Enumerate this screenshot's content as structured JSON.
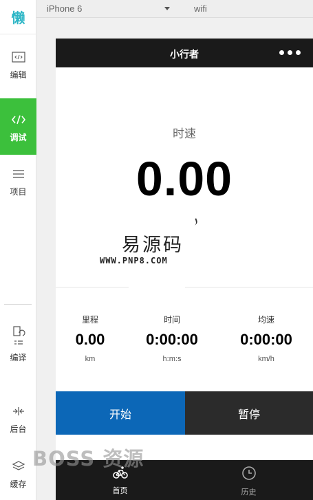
{
  "sidebar": {
    "logo": "懒",
    "tools": [
      {
        "name": "edit",
        "label": "编辑"
      },
      {
        "name": "debug",
        "label": "调试"
      },
      {
        "name": "project",
        "label": "项目"
      },
      {
        "name": "compile",
        "label": "编译"
      },
      {
        "name": "background",
        "label": "后台"
      },
      {
        "name": "cache",
        "label": "缓存"
      }
    ],
    "active_color": "#3cc03c"
  },
  "toolbar": {
    "device": "iPhone 6",
    "network": "wifi"
  },
  "navbar": {
    "title": "小行者"
  },
  "speed": {
    "label": "时速",
    "value": "0.00"
  },
  "watermark": {
    "title": "易源码",
    "url": "WWW.PNP8.COM",
    "brand": "BOSS 资源"
  },
  "stats": [
    {
      "label": "里程",
      "value": "0.00",
      "unit": "km"
    },
    {
      "label": "时间",
      "value": "0:00:00",
      "unit": "h:m:s"
    },
    {
      "label": "均速",
      "value": "0:00:00",
      "unit": "km/h"
    }
  ],
  "buttons": {
    "start": "开始",
    "pause": "暂停",
    "start_color": "#0c67b7",
    "pause_color": "#2b2b2b"
  },
  "tabs": [
    {
      "label": "首页",
      "icon": "bicycle-icon",
      "active": true
    },
    {
      "label": "历史",
      "icon": "clock-icon",
      "active": false
    }
  ]
}
